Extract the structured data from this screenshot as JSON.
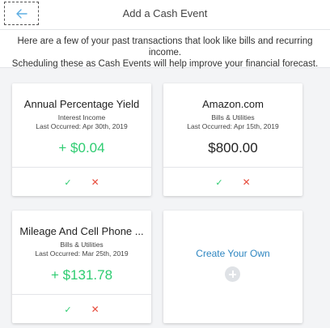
{
  "header": {
    "title": "Add a Cash Event",
    "back_icon": "back-arrow-icon",
    "accent": "#5dade2"
  },
  "intro": {
    "line1": "Here are a few of your past transactions that look like bills and recurring income.",
    "line2": "Scheduling these as Cash Events will help improve your financial forecast."
  },
  "cards": [
    {
      "name": "Annual Percentage Yield",
      "category": "Interest Income",
      "last_occurred": "Last Occurred: Apr 30th, 2019",
      "amount": "+ $0.04",
      "type": "income",
      "accept": "✓",
      "reject": "✕"
    },
    {
      "name": "Amazon.com",
      "category": "Bills & Utilities",
      "last_occurred": "Last Occurred: Apr 15th, 2019",
      "amount": "$800.00",
      "type": "expense",
      "accept": "✓",
      "reject": "✕"
    },
    {
      "name": "Mileage And Cell Phone ...",
      "category": "Bills & Utilities",
      "last_occurred": "Last Occurred: Mar 25th, 2019",
      "amount": "+ $131.78",
      "type": "income",
      "accept": "✓",
      "reject": "✕"
    }
  ],
  "create_card": {
    "label": "Create Your Own",
    "icon": "plus-circle-icon"
  },
  "colors": {
    "income": "#2ecc71",
    "reject": "#e74c3c",
    "link": "#2e86c1"
  }
}
